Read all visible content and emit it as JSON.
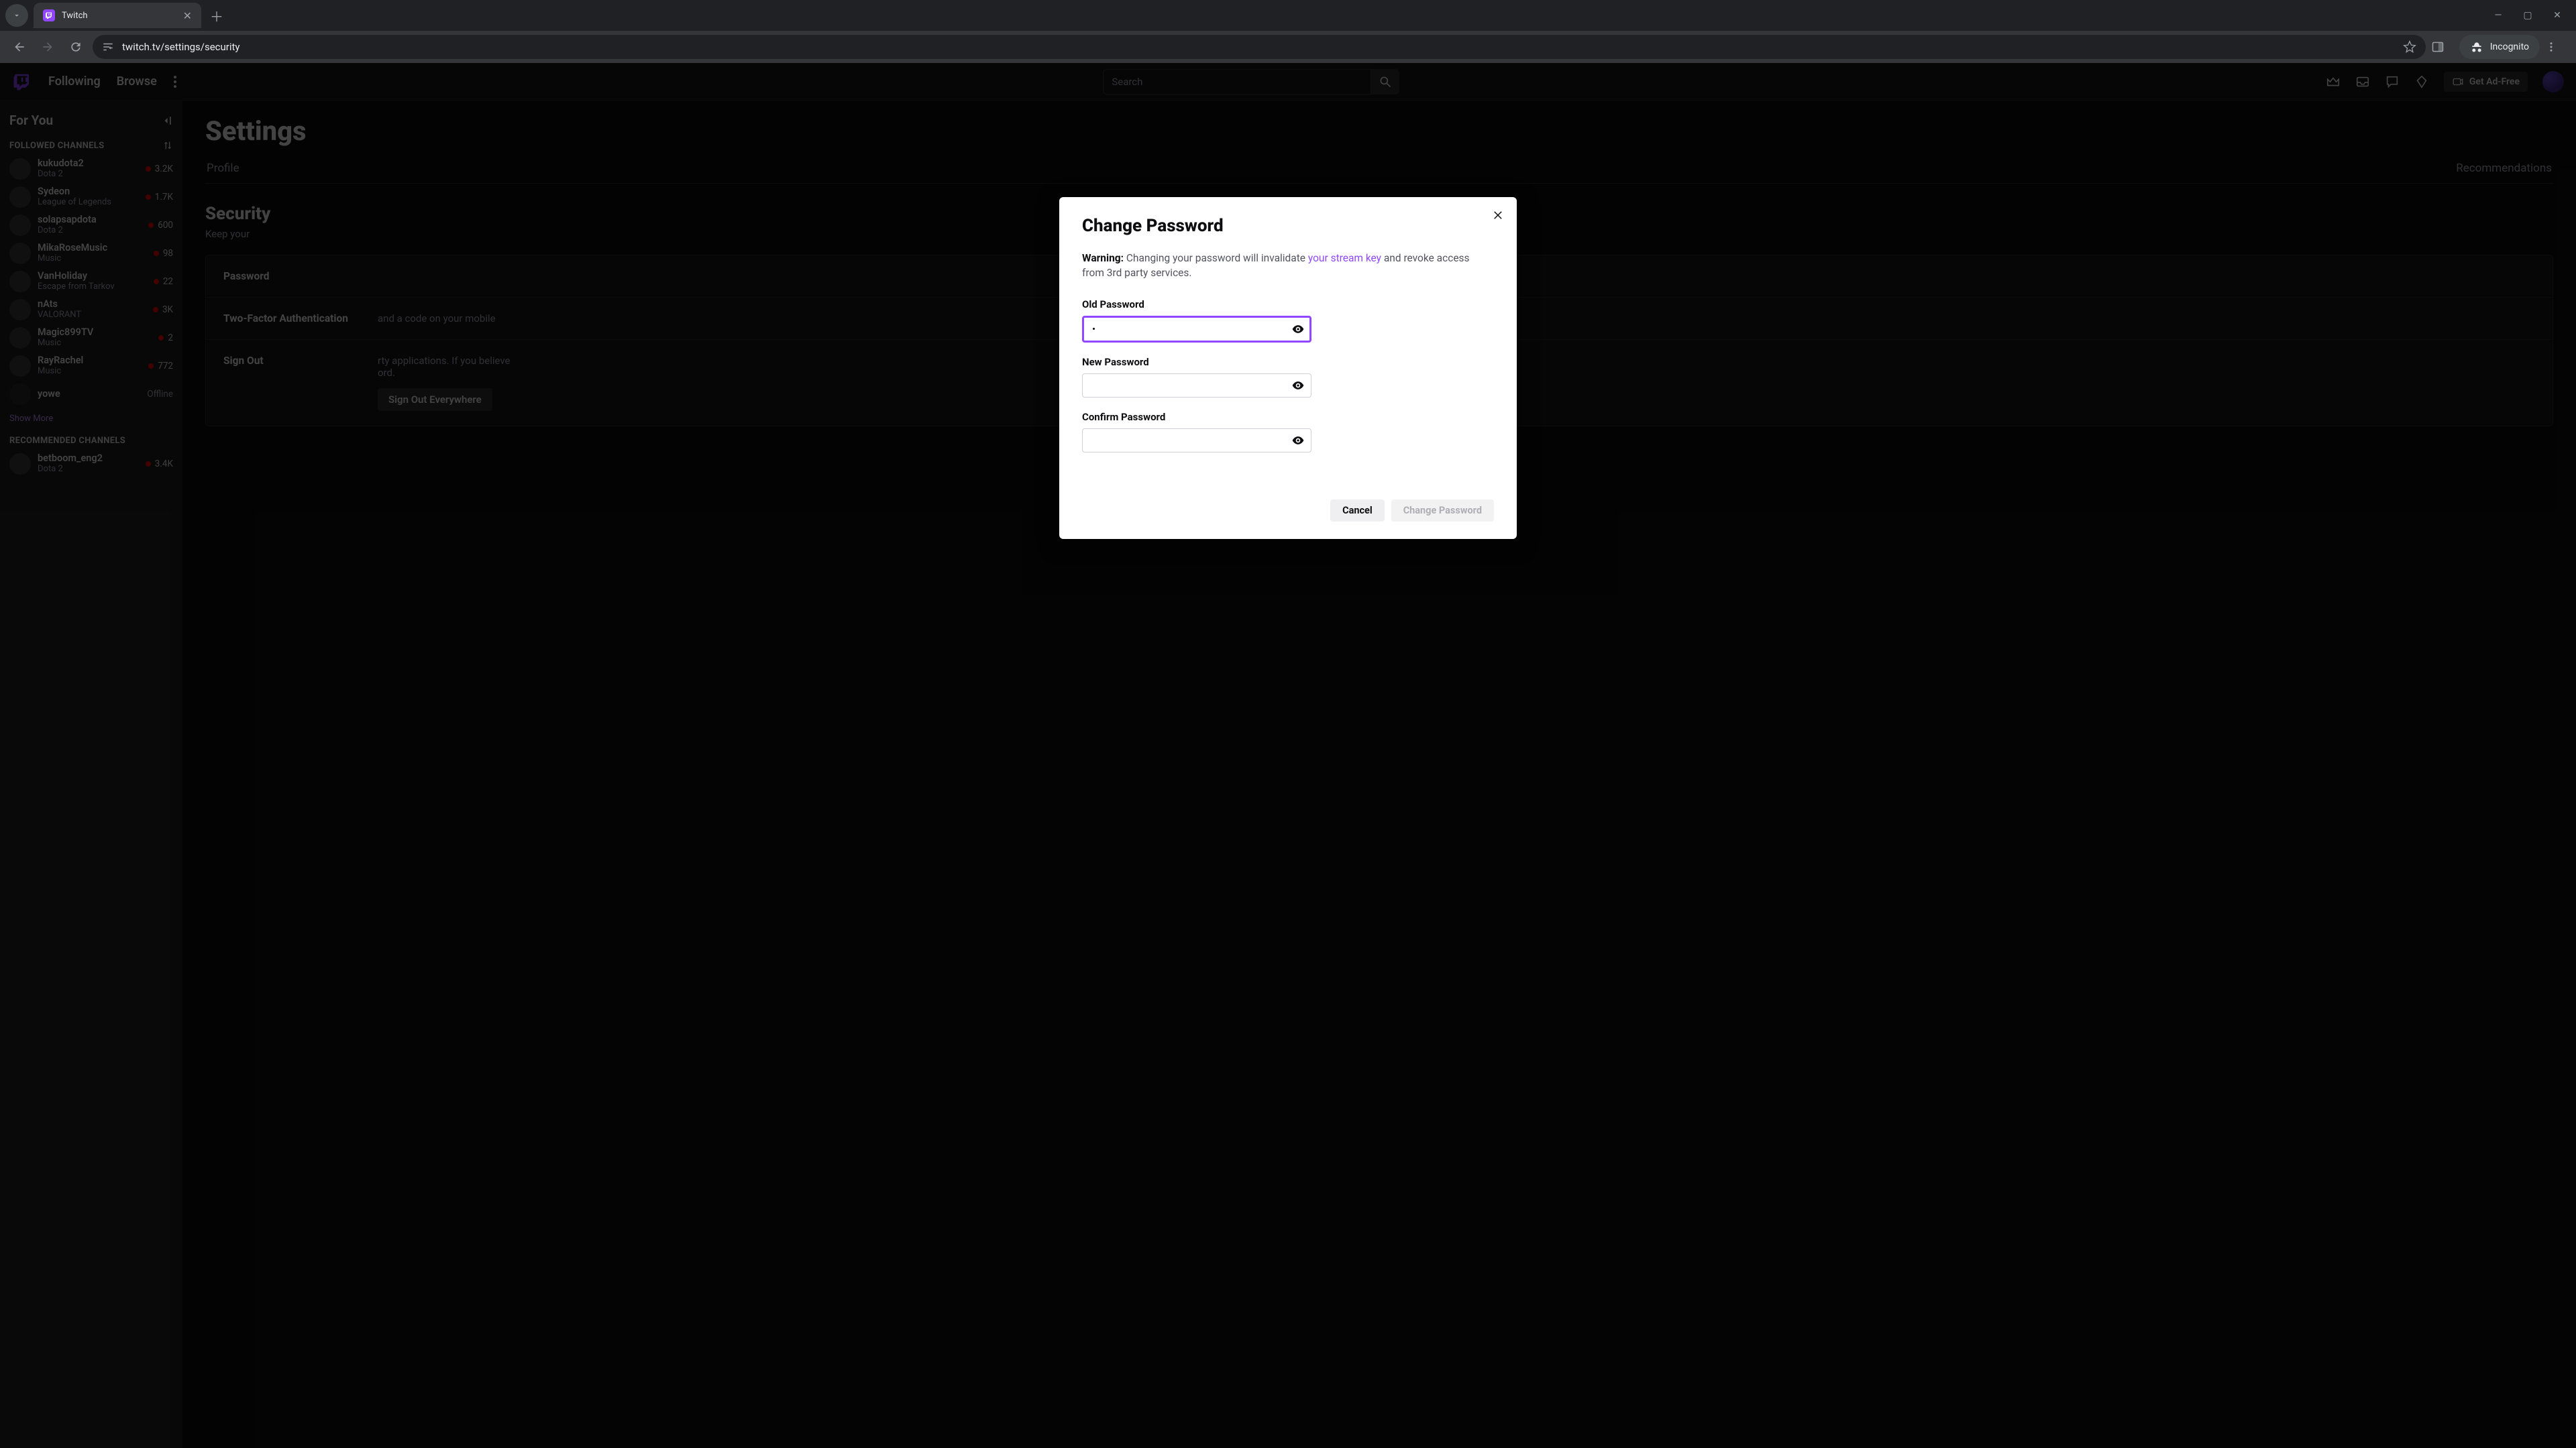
{
  "browser": {
    "tab_title": "Twitch",
    "url": "twitch.tv/settings/security",
    "incognito_label": "Incognito"
  },
  "top_nav": {
    "following": "Following",
    "browse": "Browse",
    "search_placeholder": "Search",
    "ad_free": "Get Ad-Free"
  },
  "sidebar": {
    "for_you": "For You",
    "followed_header": "FOLLOWED CHANNELS",
    "recommended_header": "RECOMMENDED CHANNELS",
    "show_more": "Show More",
    "followed": [
      {
        "name": "kukudota2",
        "game": "Dota 2",
        "viewers": "3.2K",
        "live": true
      },
      {
        "name": "Sydeon",
        "game": "League of Legends",
        "viewers": "1.7K",
        "live": true
      },
      {
        "name": "solapsapdota",
        "game": "Dota 2",
        "viewers": "600",
        "live": true
      },
      {
        "name": "MikaRoseMusic",
        "game": "Music",
        "viewers": "98",
        "live": true
      },
      {
        "name": "VanHoliday",
        "game": "Escape from Tarkov",
        "viewers": "22",
        "live": true
      },
      {
        "name": "nAts",
        "game": "VALORANT",
        "viewers": "3K",
        "live": true
      },
      {
        "name": "Magic899TV",
        "game": "Music",
        "viewers": "2",
        "live": true
      },
      {
        "name": "RayRachel",
        "game": "Music",
        "viewers": "772",
        "live": true
      },
      {
        "name": "yowe",
        "game": "",
        "viewers": "Offline",
        "live": false
      }
    ],
    "recommended": [
      {
        "name": "betboom_eng2",
        "game": "Dota 2",
        "viewers": "3.4K",
        "live": true
      }
    ]
  },
  "settings": {
    "page_title": "Settings",
    "tabs": {
      "profile": "Profile",
      "recs": "Recommendations"
    },
    "security_title": "Security",
    "security_sub": "Keep your ",
    "rows": {
      "password_label": "Password",
      "twofa_label": "Two-Factor Authentication",
      "twofa_hint_tail": " and a code on your mobile",
      "signout_label": "Sign Out",
      "signout_hint_tail": "rty applications. If you believe",
      "signout_hint_tail2": "ord.",
      "signout_btn": "Sign Out Everywhere"
    }
  },
  "modal": {
    "title": "Change Password",
    "warning_prefix": "Warning:",
    "warning_text_a": " Changing your password will invalidate ",
    "warning_link": "your stream key",
    "warning_text_b": " and revoke access from 3rd party services.",
    "old_label": "Old Password",
    "new_label": "New Password",
    "confirm_label": "Confirm Password",
    "old_value": "•",
    "cancel": "Cancel",
    "submit": "Change Password"
  }
}
